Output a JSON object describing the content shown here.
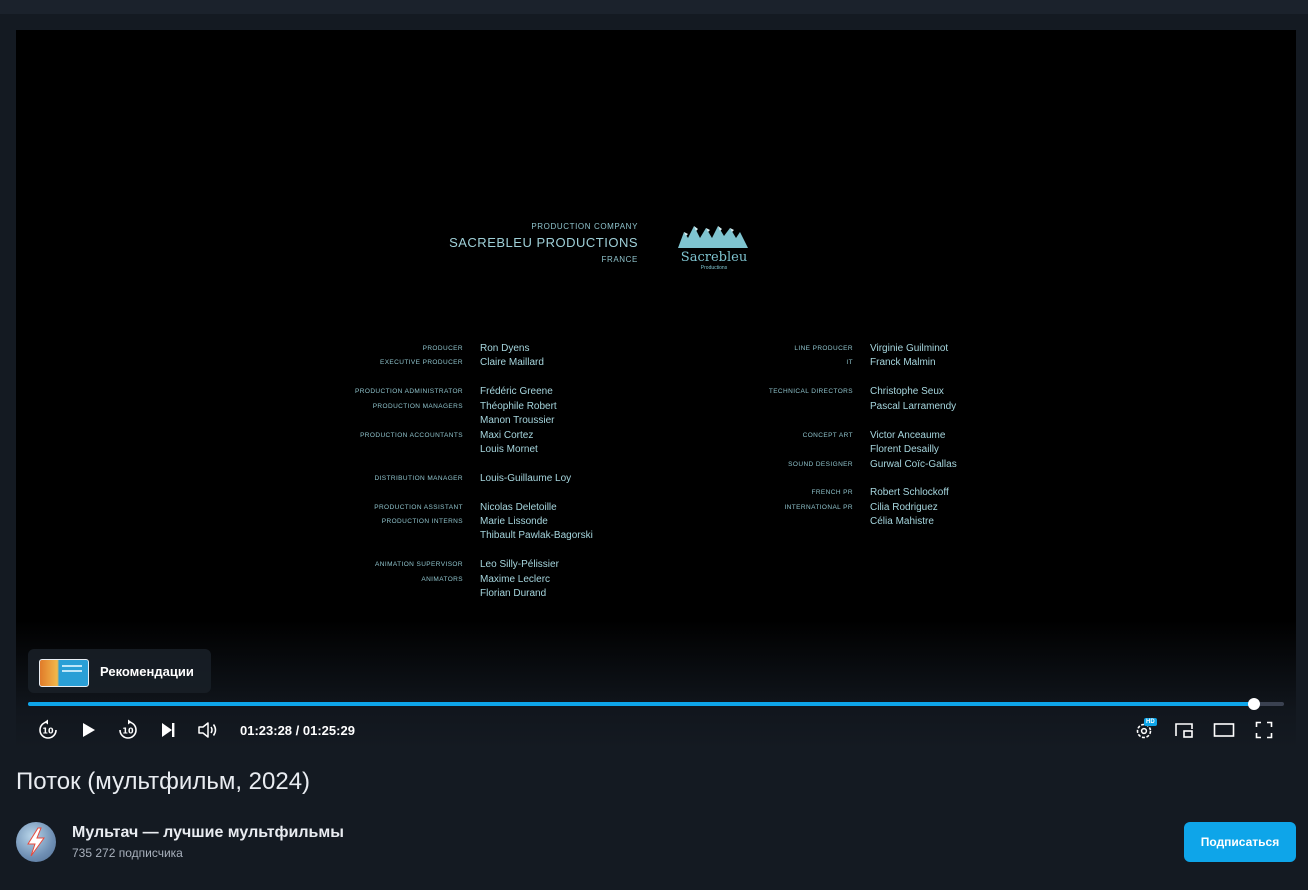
{
  "credits": {
    "company_caption": "PRODUCTION COMPANY",
    "company_name": "SACREBLEU PRODUCTIONS",
    "company_country": "FRANCE",
    "logo_word": "Sacrebleu",
    "logo_sub": "Productions",
    "left_roles": [
      {
        "role": "PRODUCER",
        "name": "Ron Dyens"
      },
      {
        "role": "EXECUTIVE PRODUCER",
        "name": "Claire Maillard"
      },
      {
        "role": "PRODUCTION ADMINISTRATOR",
        "name": "Frédéric Greene"
      },
      {
        "role": "PRODUCTION MANAGERS",
        "name": "Théophile Robert"
      },
      {
        "role": "",
        "name": "Manon Troussier"
      },
      {
        "role": "PRODUCTION ACCOUNTANTS",
        "name": "Maxi Cortez"
      },
      {
        "role": "",
        "name": "Louis Mornet"
      },
      {
        "role": "DISTRIBUTION MANAGER",
        "name": "Louis-Guillaume Loy"
      },
      {
        "role": "PRODUCTION ASSISTANT",
        "name": "Nicolas Deletoille"
      },
      {
        "role": "PRODUCTION INTERNS",
        "name": "Marie Lissonde"
      },
      {
        "role": "",
        "name": "Thibault Pawlak-Bagorski"
      },
      {
        "role": "ANIMATION SUPERVISOR",
        "name": "Leo Silly-Pélissier"
      },
      {
        "role": "ANIMATORS",
        "name": "Maxime Leclerc"
      },
      {
        "role": "",
        "name": "Florian Durand"
      }
    ],
    "right_roles": [
      {
        "role": "LINE PRODUCER",
        "name": "Virginie Guilminot"
      },
      {
        "role": "IT",
        "name": "Franck Malmin"
      },
      {
        "role": "TECHNICAL DIRECTORS",
        "name": "Christophe Seux"
      },
      {
        "role": "",
        "name": "Pascal Larramendy"
      },
      {
        "role": "CONCEPT ART",
        "name": "Victor Anceaume"
      },
      {
        "role": "",
        "name": "Florent Desailly"
      },
      {
        "role": "SOUND DESIGNER",
        "name": "Gurwal Coïc-Gallas"
      },
      {
        "role": "FRENCH PR",
        "name": "Robert Schlockoff"
      },
      {
        "role": "INTERNATIONAL PR",
        "name": "Cilia Rodriguez"
      },
      {
        "role": "",
        "name": "Célia Mahistre"
      }
    ]
  },
  "player": {
    "recommendations_label": "Рекомендации",
    "current_time": "01:23:28",
    "duration": "01:25:29",
    "time_separator": " / ",
    "progress_fraction": 0.976,
    "hd_badge": "HD"
  },
  "video": {
    "title": "Поток (мультфильм, 2024)"
  },
  "channel": {
    "name": "Мультач — лучшие мультфильмы",
    "subscribers": "735 272 подписчика",
    "subscribe_label": "Подписаться"
  },
  "colors": {
    "accent": "#0ea5e9",
    "background": "#141a22",
    "credits_text": "#8fc3cc"
  }
}
